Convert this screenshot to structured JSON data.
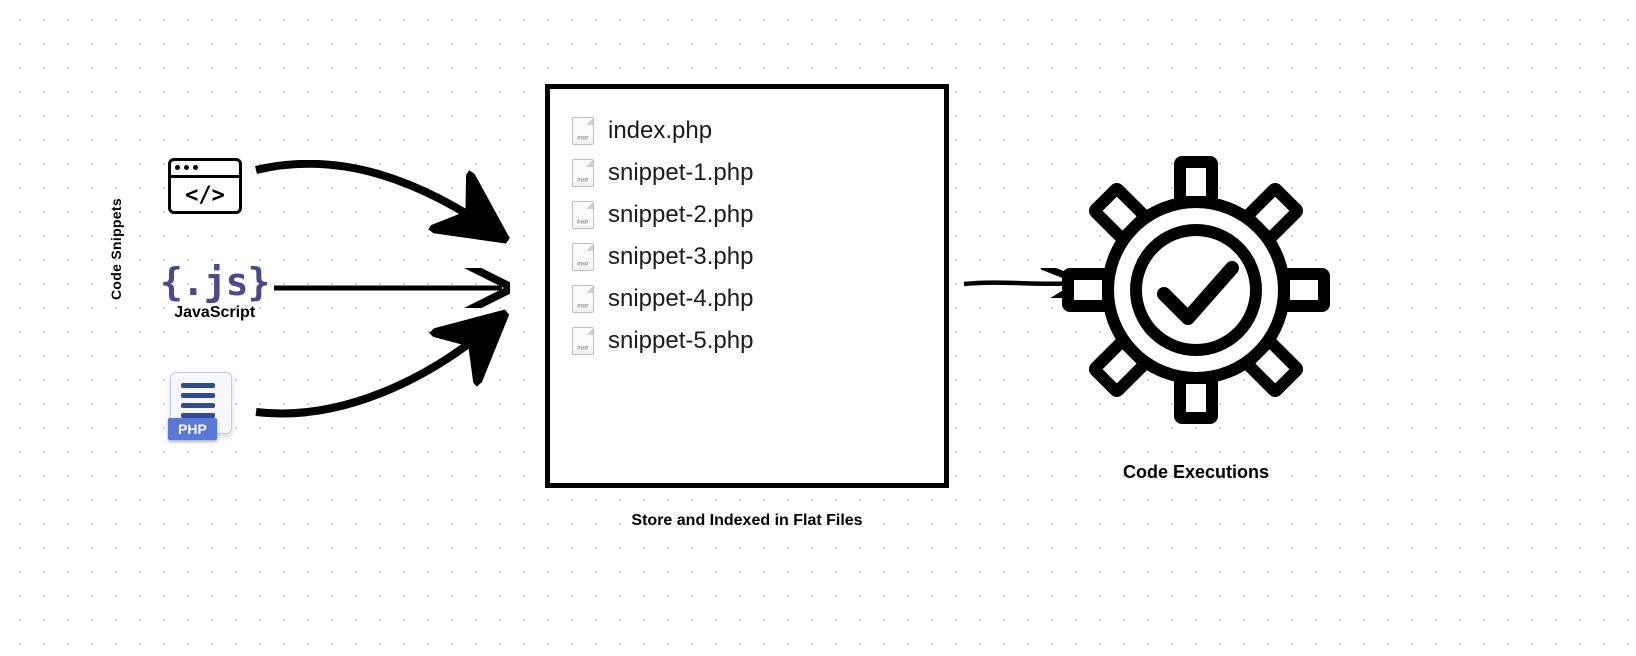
{
  "left": {
    "group_label": "Code Snippets",
    "code_glyph": "</>",
    "js_glyph": "{.js}",
    "js_label": "JavaScript",
    "php_label": "PHP"
  },
  "files": [
    "index.php",
    "snippet-1.php",
    "snippet-2.php",
    "snippet-3.php",
    "snippet-4.php",
    "snippet-5.php"
  ],
  "center_caption": "Store and Indexed in Flat Files",
  "right_caption": "Code Executions"
}
